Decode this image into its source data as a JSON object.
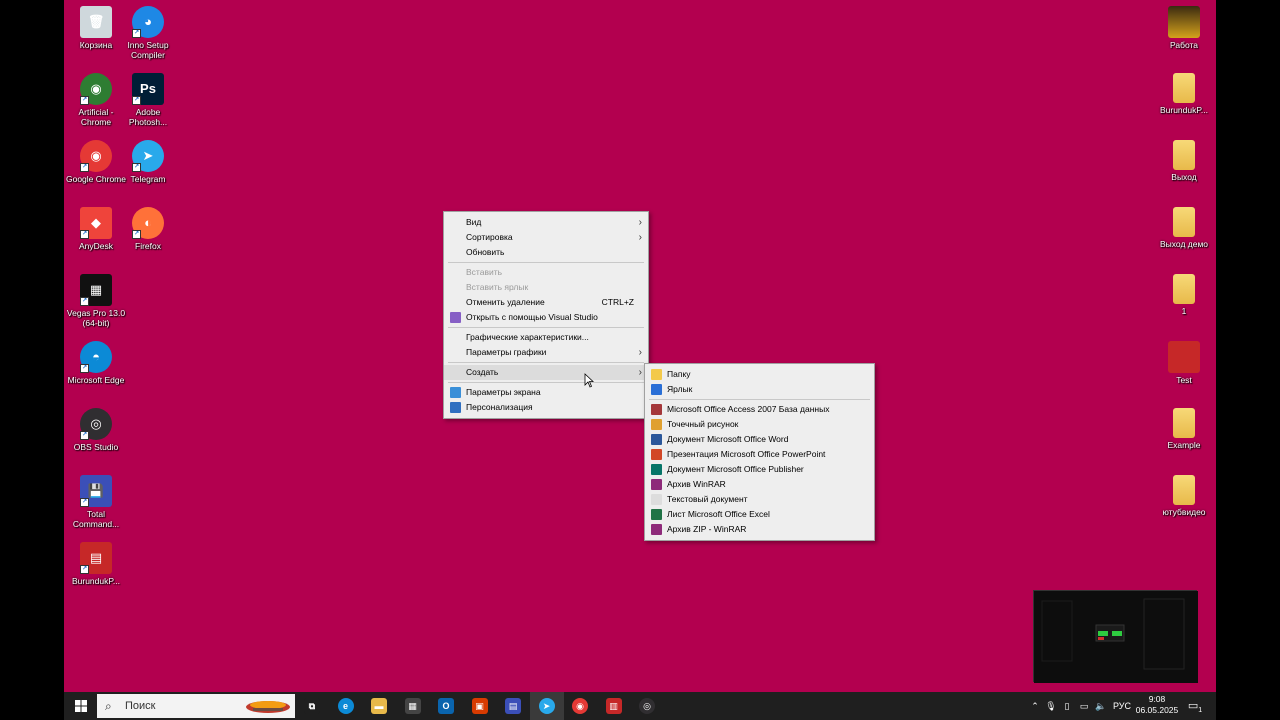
{
  "desktop": {
    "left_icons": [
      {
        "label": "Корзина",
        "icon": "recycle-bin-icon",
        "glyph": "🗑",
        "color": "#cfd8dc"
      },
      {
        "label": "Inno Setup Compiler",
        "icon": "inno-setup-icon",
        "glyph": "◕",
        "color": "#1e88e5"
      },
      {
        "label": "Artificial - Chrome",
        "icon": "chrome-profile-icon",
        "glyph": "◉",
        "color": "#2e7d32"
      },
      {
        "label": "Adobe Photosh...",
        "icon": "photoshop-icon",
        "glyph": "Ps",
        "color": "#001e36"
      },
      {
        "label": "Google Chrome",
        "icon": "chrome-icon",
        "glyph": "◉",
        "color": "#e53935"
      },
      {
        "label": "Telegram",
        "icon": "telegram-icon",
        "glyph": "➤",
        "color": "#29a9eb"
      },
      {
        "label": "AnyDesk",
        "icon": "anydesk-icon",
        "glyph": "◆",
        "color": "#ef443b"
      },
      {
        "label": "Firefox",
        "icon": "firefox-icon",
        "glyph": "◐",
        "color": "#ff7139"
      },
      {
        "label": "Vegas Pro 13.0 (64-bit)",
        "icon": "vegas-pro-icon",
        "glyph": "▦",
        "color": "#111111"
      },
      {
        "label": "Microsoft Edge",
        "icon": "edge-icon",
        "glyph": "◓",
        "color": "#0c8ad6"
      },
      {
        "label": "OBS Studio",
        "icon": "obs-icon",
        "glyph": "◎",
        "color": "#302e31"
      },
      {
        "label": "Total Command...",
        "icon": "total-commander-icon",
        "glyph": "💾",
        "color": "#3b4fb8"
      },
      {
        "label": "BurundukP...",
        "icon": "burunduk-icon",
        "glyph": "▤",
        "color": "#c62828"
      }
    ],
    "right_icons": [
      {
        "label": "Работа",
        "icon": "folder-work-icon"
      },
      {
        "label": "BurundukP...",
        "icon": "folder-icon"
      },
      {
        "label": "Выход",
        "icon": "folder-exit-icon"
      },
      {
        "label": "Выход демо",
        "icon": "folder-exit-demo-icon"
      },
      {
        "label": "1",
        "icon": "folder-1-icon"
      },
      {
        "label": "Test",
        "icon": "test-app-icon"
      },
      {
        "label": "Example",
        "icon": "folder-example-icon"
      },
      {
        "label": "ютубвидео",
        "icon": "folder-youtube-icon"
      }
    ]
  },
  "context_menu": {
    "items": [
      {
        "label": "Вид",
        "submenu": true
      },
      {
        "label": "Сортировка",
        "submenu": true
      },
      {
        "label": "Обновить"
      },
      {
        "sep": true
      },
      {
        "label": "Вставить",
        "disabled": true
      },
      {
        "label": "Вставить ярлык",
        "disabled": true
      },
      {
        "label": "Отменить удаление",
        "shortcut": "CTRL+Z"
      },
      {
        "label": "Открыть с помощью Visual Studio",
        "icon": "visual-studio-icon"
      },
      {
        "sep": true
      },
      {
        "label": "Графические характеристики..."
      },
      {
        "label": "Параметры графики",
        "submenu": true
      },
      {
        "sep": true
      },
      {
        "label": "Создать",
        "submenu": true,
        "hover": true
      },
      {
        "sep": true
      },
      {
        "label": "Параметры экрана",
        "icon": "display-settings-icon"
      },
      {
        "label": "Персонализация",
        "icon": "personalization-icon"
      }
    ]
  },
  "create_submenu": {
    "items": [
      {
        "label": "Папку",
        "icon": "folder-icon",
        "color": "#f3c94a"
      },
      {
        "label": "Ярлык",
        "icon": "shortcut-icon",
        "color": "#2a6fd6"
      },
      {
        "sep": true
      },
      {
        "label": "Microsoft Office Access 2007 База данных",
        "icon": "access-icon",
        "color": "#a4373a"
      },
      {
        "label": "Точечный рисунок",
        "icon": "bitmap-icon",
        "color": "#e0a030"
      },
      {
        "label": "Документ Microsoft Office Word",
        "icon": "word-icon",
        "color": "#2b579a"
      },
      {
        "label": "Презентация Microsoft Office PowerPoint",
        "icon": "powerpoint-icon",
        "color": "#d24726"
      },
      {
        "label": "Документ Microsoft Office Publisher",
        "icon": "publisher-icon",
        "color": "#077568"
      },
      {
        "label": "Архив WinRAR",
        "icon": "winrar-icon",
        "color": "#8e2a7a"
      },
      {
        "label": "Текстовый документ",
        "icon": "text-document-icon",
        "color": "#dddddd"
      },
      {
        "label": "Лист Microsoft Office Excel",
        "icon": "excel-icon",
        "color": "#217346"
      },
      {
        "label": "Архив ZIP - WinRAR",
        "icon": "zip-winrar-icon",
        "color": "#8e2a7a"
      }
    ]
  },
  "taskbar": {
    "search_placeholder": "Поиск",
    "apps": [
      {
        "icon": "task-view-icon",
        "glyph": "⧉",
        "color": "#1f1f1f"
      },
      {
        "icon": "edge-taskbar-icon",
        "glyph": "e",
        "color": "#0c8ad6"
      },
      {
        "icon": "explorer-taskbar-icon",
        "glyph": "▬",
        "color": "#e8b94a"
      },
      {
        "icon": "store-taskbar-icon",
        "glyph": "▦",
        "color": "#444444"
      },
      {
        "icon": "outlook-taskbar-icon",
        "glyph": "O",
        "color": "#0a64ad"
      },
      {
        "icon": "office-taskbar-icon",
        "glyph": "▣",
        "color": "#d83b01"
      },
      {
        "icon": "total-commander-taskbar-icon",
        "glyph": "▤",
        "color": "#3b4fb8"
      },
      {
        "icon": "telegram-taskbar-icon",
        "glyph": "➤",
        "color": "#29a9eb",
        "active": true
      },
      {
        "icon": "chrome-taskbar-icon",
        "glyph": "◉",
        "color": "#e53935"
      },
      {
        "icon": "burunduk-taskbar-icon",
        "glyph": "▥",
        "color": "#c62828"
      },
      {
        "icon": "obs-taskbar-icon",
        "glyph": "◎",
        "color": "#302e31"
      }
    ],
    "language": "РУС",
    "time": "9:08",
    "date": "06.05.2025",
    "notification_count": "1"
  },
  "colors": {
    "desktop_bg": "#b3004f",
    "taskbar_bg": "#1f1f1f"
  }
}
